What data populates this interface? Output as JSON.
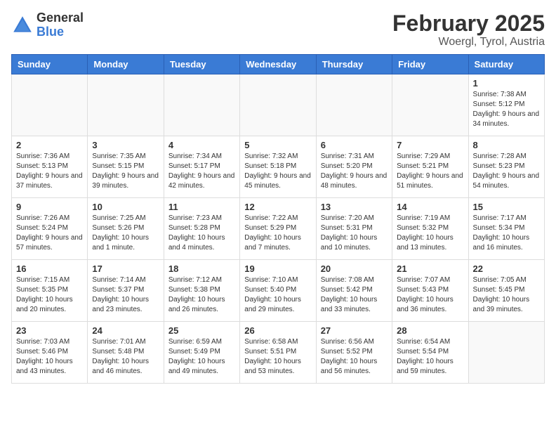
{
  "header": {
    "logo_general": "General",
    "logo_blue": "Blue",
    "month_year": "February 2025",
    "location": "Woergl, Tyrol, Austria"
  },
  "weekdays": [
    "Sunday",
    "Monday",
    "Tuesday",
    "Wednesday",
    "Thursday",
    "Friday",
    "Saturday"
  ],
  "weeks": [
    [
      {
        "day": "",
        "info": ""
      },
      {
        "day": "",
        "info": ""
      },
      {
        "day": "",
        "info": ""
      },
      {
        "day": "",
        "info": ""
      },
      {
        "day": "",
        "info": ""
      },
      {
        "day": "",
        "info": ""
      },
      {
        "day": "1",
        "info": "Sunrise: 7:38 AM\nSunset: 5:12 PM\nDaylight: 9 hours and 34 minutes."
      }
    ],
    [
      {
        "day": "2",
        "info": "Sunrise: 7:36 AM\nSunset: 5:13 PM\nDaylight: 9 hours and 37 minutes."
      },
      {
        "day": "3",
        "info": "Sunrise: 7:35 AM\nSunset: 5:15 PM\nDaylight: 9 hours and 39 minutes."
      },
      {
        "day": "4",
        "info": "Sunrise: 7:34 AM\nSunset: 5:17 PM\nDaylight: 9 hours and 42 minutes."
      },
      {
        "day": "5",
        "info": "Sunrise: 7:32 AM\nSunset: 5:18 PM\nDaylight: 9 hours and 45 minutes."
      },
      {
        "day": "6",
        "info": "Sunrise: 7:31 AM\nSunset: 5:20 PM\nDaylight: 9 hours and 48 minutes."
      },
      {
        "day": "7",
        "info": "Sunrise: 7:29 AM\nSunset: 5:21 PM\nDaylight: 9 hours and 51 minutes."
      },
      {
        "day": "8",
        "info": "Sunrise: 7:28 AM\nSunset: 5:23 PM\nDaylight: 9 hours and 54 minutes."
      }
    ],
    [
      {
        "day": "9",
        "info": "Sunrise: 7:26 AM\nSunset: 5:24 PM\nDaylight: 9 hours and 57 minutes."
      },
      {
        "day": "10",
        "info": "Sunrise: 7:25 AM\nSunset: 5:26 PM\nDaylight: 10 hours and 1 minute."
      },
      {
        "day": "11",
        "info": "Sunrise: 7:23 AM\nSunset: 5:28 PM\nDaylight: 10 hours and 4 minutes."
      },
      {
        "day": "12",
        "info": "Sunrise: 7:22 AM\nSunset: 5:29 PM\nDaylight: 10 hours and 7 minutes."
      },
      {
        "day": "13",
        "info": "Sunrise: 7:20 AM\nSunset: 5:31 PM\nDaylight: 10 hours and 10 minutes."
      },
      {
        "day": "14",
        "info": "Sunrise: 7:19 AM\nSunset: 5:32 PM\nDaylight: 10 hours and 13 minutes."
      },
      {
        "day": "15",
        "info": "Sunrise: 7:17 AM\nSunset: 5:34 PM\nDaylight: 10 hours and 16 minutes."
      }
    ],
    [
      {
        "day": "16",
        "info": "Sunrise: 7:15 AM\nSunset: 5:35 PM\nDaylight: 10 hours and 20 minutes."
      },
      {
        "day": "17",
        "info": "Sunrise: 7:14 AM\nSunset: 5:37 PM\nDaylight: 10 hours and 23 minutes."
      },
      {
        "day": "18",
        "info": "Sunrise: 7:12 AM\nSunset: 5:38 PM\nDaylight: 10 hours and 26 minutes."
      },
      {
        "day": "19",
        "info": "Sunrise: 7:10 AM\nSunset: 5:40 PM\nDaylight: 10 hours and 29 minutes."
      },
      {
        "day": "20",
        "info": "Sunrise: 7:08 AM\nSunset: 5:42 PM\nDaylight: 10 hours and 33 minutes."
      },
      {
        "day": "21",
        "info": "Sunrise: 7:07 AM\nSunset: 5:43 PM\nDaylight: 10 hours and 36 minutes."
      },
      {
        "day": "22",
        "info": "Sunrise: 7:05 AM\nSunset: 5:45 PM\nDaylight: 10 hours and 39 minutes."
      }
    ],
    [
      {
        "day": "23",
        "info": "Sunrise: 7:03 AM\nSunset: 5:46 PM\nDaylight: 10 hours and 43 minutes."
      },
      {
        "day": "24",
        "info": "Sunrise: 7:01 AM\nSunset: 5:48 PM\nDaylight: 10 hours and 46 minutes."
      },
      {
        "day": "25",
        "info": "Sunrise: 6:59 AM\nSunset: 5:49 PM\nDaylight: 10 hours and 49 minutes."
      },
      {
        "day": "26",
        "info": "Sunrise: 6:58 AM\nSunset: 5:51 PM\nDaylight: 10 hours and 53 minutes."
      },
      {
        "day": "27",
        "info": "Sunrise: 6:56 AM\nSunset: 5:52 PM\nDaylight: 10 hours and 56 minutes."
      },
      {
        "day": "28",
        "info": "Sunrise: 6:54 AM\nSunset: 5:54 PM\nDaylight: 10 hours and 59 minutes."
      },
      {
        "day": "",
        "info": ""
      }
    ]
  ]
}
